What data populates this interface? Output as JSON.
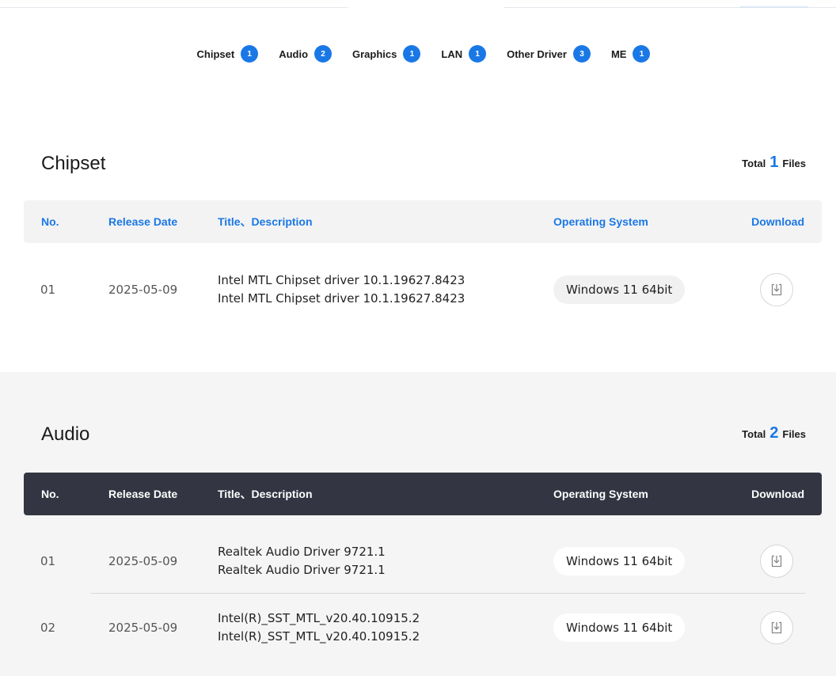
{
  "tabs": [
    {
      "label": "Chipset",
      "count": "1"
    },
    {
      "label": "Audio",
      "count": "2"
    },
    {
      "label": "Graphics",
      "count": "1"
    },
    {
      "label": "LAN",
      "count": "1"
    },
    {
      "label": "Other Driver",
      "count": "3"
    },
    {
      "label": "ME",
      "count": "1"
    }
  ],
  "columns": {
    "no": "No.",
    "date": "Release Date",
    "title": "Title、Description",
    "os": "Operating System",
    "download": "Download"
  },
  "chipset": {
    "title": "Chipset",
    "total_prefix": "Total",
    "total_count": "1",
    "total_suffix": "Files",
    "rows": [
      {
        "no": "01",
        "date": "2025-05-09",
        "title": "Intel MTL Chipset driver 10.1.19627.8423",
        "desc": "Intel MTL Chipset driver 10.1.19627.8423",
        "os": "Windows 11 64bit",
        "icon": "download-icon"
      }
    ]
  },
  "audio": {
    "title": "Audio",
    "total_prefix": "Total",
    "total_count": "2",
    "total_suffix": "Files",
    "rows": [
      {
        "no": "01",
        "date": "2025-05-09",
        "title": "Realtek Audio Driver 9721.1",
        "desc": "Realtek Audio Driver 9721.1",
        "os": "Windows 11 64bit",
        "icon": "download-icon"
      },
      {
        "no": "02",
        "date": "2025-05-09",
        "title": "Intel(R)_SST_MTL_v20.40.10915.2",
        "desc": "Intel(R)_SST_MTL_v20.40.10915.2",
        "os": "Windows 11 64bit",
        "icon": "download-icon"
      }
    ]
  },
  "colors": {
    "accent": "#1a78e6",
    "dark_header": "#333642",
    "light_header": "#f3f3f3",
    "section_bg": "#f5f5f5"
  }
}
